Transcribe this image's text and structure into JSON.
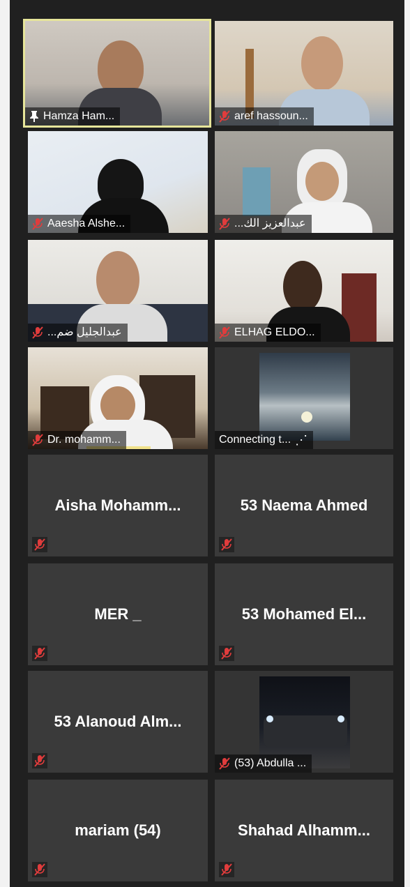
{
  "participants": [
    {
      "name": "Hamza Ham...",
      "pinned": true,
      "muted": false,
      "video": true
    },
    {
      "name": "aref hassoun...",
      "muted": true,
      "video": true
    },
    {
      "name": "Aaesha Alshe...",
      "muted": true,
      "video": true
    },
    {
      "name": "...عبدالعزيز الك",
      "muted": true,
      "video": true
    },
    {
      "name": "...عبدالجليل ضم",
      "muted": true,
      "video": true
    },
    {
      "name": "ELHAG ELDO...",
      "muted": true,
      "video": true
    },
    {
      "name": "Dr. mohamm...",
      "muted": true,
      "video": true
    },
    {
      "name": "Connecting t...",
      "muted": false,
      "video": true,
      "status": "connecting"
    },
    {
      "name": "Aisha  Mohamm...",
      "muted": true,
      "video": false
    },
    {
      "name": "53 Naema Ahmed",
      "muted": true,
      "video": false
    },
    {
      "name": "MER _",
      "muted": true,
      "video": false
    },
    {
      "name": "53  Mohamed  El...",
      "muted": true,
      "video": false
    },
    {
      "name": "53  Alanoud  Alm...",
      "muted": true,
      "video": false
    },
    {
      "name": "(53) Abdulla ...",
      "muted": true,
      "video": true
    },
    {
      "name": "mariam (54)",
      "muted": true,
      "video": false
    },
    {
      "name": "Shahad  Alhamm...",
      "muted": true,
      "video": false
    }
  ],
  "colors": {
    "active_speaker_border": "#e6e59a",
    "tile_bg": "#3a3a3a",
    "muted_icon": "#e03c3c"
  },
  "icons": {
    "muted": "microphone-muted-icon",
    "pin": "pin-icon",
    "connecting": "ellipsis-icon"
  }
}
